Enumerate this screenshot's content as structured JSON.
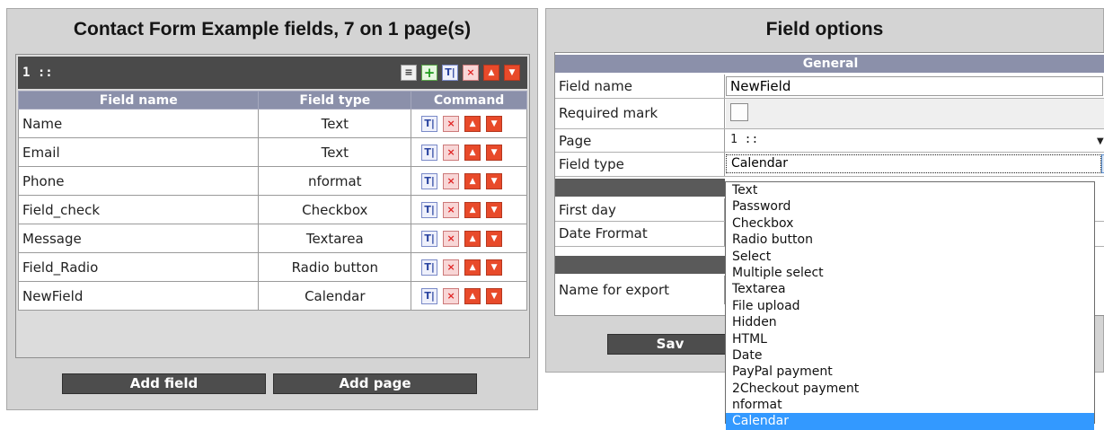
{
  "left_panel": {
    "title": "Contact Form Example fields, 7 on 1 page(s)",
    "page_label": "1 ::",
    "columns": [
      "Field name",
      "Field type",
      "Command"
    ],
    "rows": [
      {
        "name": "Name",
        "type": "Text"
      },
      {
        "name": "Email",
        "type": "Text"
      },
      {
        "name": "Phone",
        "type": "nformat"
      },
      {
        "name": "Field_check",
        "type": "Checkbox"
      },
      {
        "name": "Message",
        "type": "Textarea"
      },
      {
        "name": "Field_Radio",
        "type": "Radio button"
      },
      {
        "name": "NewField",
        "type": "Calendar"
      }
    ],
    "add_field_label": "Add field",
    "add_page_label": "Add page"
  },
  "right_panel": {
    "title": "Field options",
    "general_heading": "General",
    "field_name_label": "Field name",
    "field_name_value": "NewField",
    "required_mark_label": "Required mark",
    "page_label": "Page",
    "page_value": "1 ::",
    "field_type_label": "Field type",
    "field_type_value": "Calendar",
    "first_day_label": "First day",
    "date_format_label": "Date Frormat",
    "name_for_export_label": "Name for export",
    "save_label": "Sav"
  },
  "dropdown": {
    "options": [
      "Text",
      "Password",
      "Checkbox",
      "Radio button",
      "Select",
      "Multiple select",
      "Textarea",
      "File upload",
      "Hidden",
      "HTML",
      "Date",
      "PayPal payment",
      "2Checkout payment",
      "nformat",
      "Calendar"
    ],
    "selected": "Calendar"
  },
  "icons": {
    "edit": "T|",
    "delete": "×",
    "up": "▲",
    "down": "▼",
    "list": "≡",
    "add": "+"
  },
  "colors": {
    "header_blue": "#8b90aa",
    "dark_bar": "#4a4a4a",
    "selection": "#3399ff"
  }
}
